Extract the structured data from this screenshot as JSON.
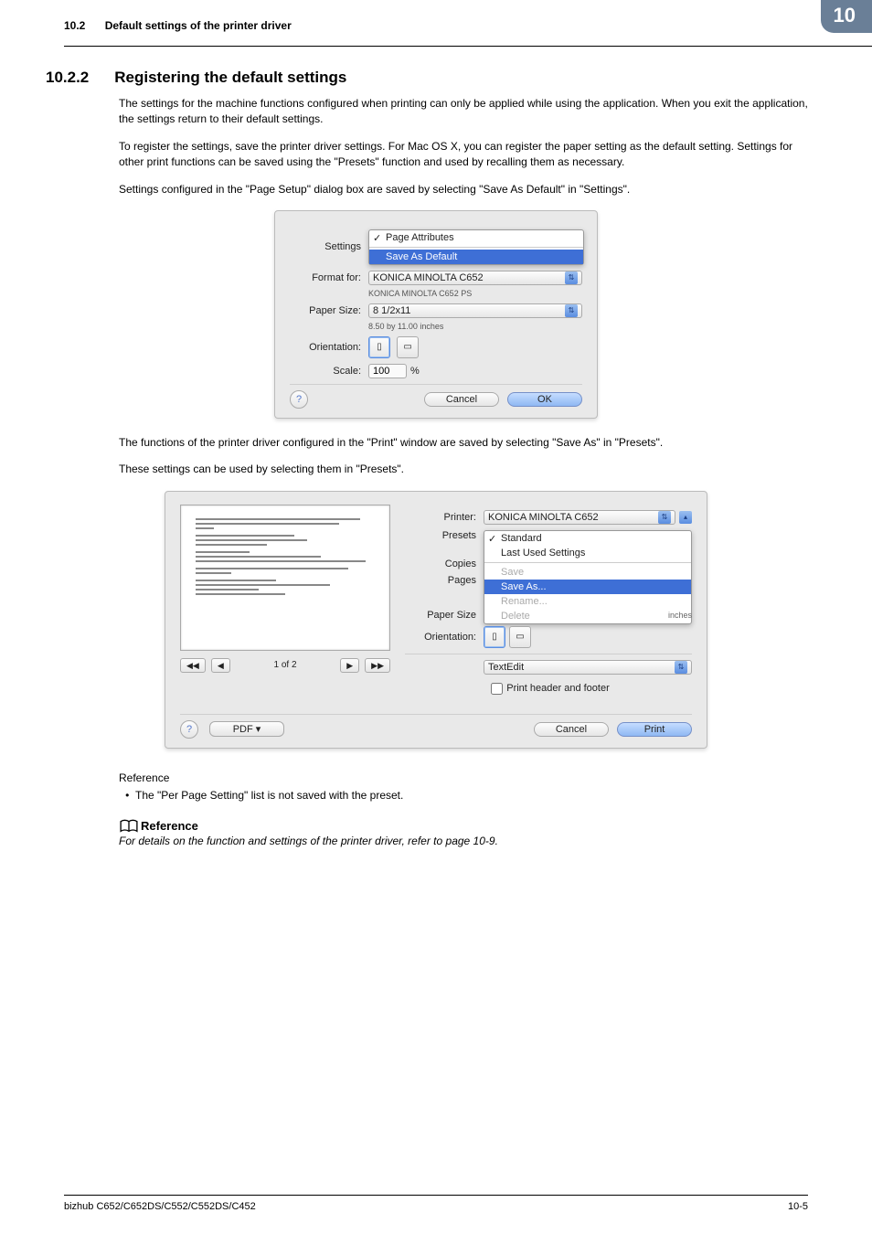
{
  "header": {
    "section_no": "10.2",
    "section_title": "Default settings of the printer driver",
    "chapter_no": "10"
  },
  "heading": {
    "number": "10.2.2",
    "title": "Registering the default settings"
  },
  "para1": "The settings for the machine functions configured when printing can only be applied while using the application. When you exit the application, the settings return to their default settings.",
  "para2": "To register the settings, save the printer driver settings. For Mac OS X, you can register the paper setting as the default setting. Settings for other print functions can be saved using the \"Presets\" function and used by recalling them as necessary.",
  "para3": "Settings configured in the \"Page Setup\" dialog box are saved by selecting \"Save As Default\" in \"Settings\".",
  "dialog1": {
    "settings_label": "Settings",
    "settings_opt_checked": "Page Attributes",
    "settings_opt_selected": "Save As Default",
    "format_for_label": "Format for:",
    "format_for_value": "KONICA MINOLTA C652",
    "format_for_sub": "KONICA MINOLTA C652 PS",
    "paper_size_label": "Paper Size:",
    "paper_size_value": "8 1/2x11",
    "paper_size_sub": "8.50 by 11.00 inches",
    "orientation_label": "Orientation:",
    "scale_label": "Scale:",
    "scale_value": "100",
    "scale_unit": "%",
    "cancel": "Cancel",
    "ok": "OK"
  },
  "para4": "The functions of the printer driver configured in the \"Print\" window are saved by selecting \"Save As\" in \"Presets\".",
  "para5": "These settings can be used by selecting them in \"Presets\".",
  "dialog2": {
    "printer_label": "Printer:",
    "printer_value": "KONICA MINOLTA C652",
    "presets_label": "Presets",
    "presets_opt_checked": "Standard",
    "presets_opt_last": "Last Used Settings",
    "presets_opt_save": "Save",
    "presets_opt_save_as": "Save As...",
    "presets_opt_rename": "Rename...",
    "presets_opt_delete": "Delete",
    "copies_label": "Copies",
    "pages_label": "Pages",
    "paper_size_label": "Paper Size",
    "paper_size_trail": "inches",
    "orientation_label": "Orientation:",
    "panel_value": "TextEdit",
    "chk_label": "Print header and footer",
    "page_counter": "1 of 2",
    "pdf_btn": "PDF ▾",
    "cancel": "Cancel",
    "print": "Print"
  },
  "reference_simple_head": "Reference",
  "reference_bullet": "The \"Per Page Setting\" list is not saved with the preset.",
  "reference_box_head": "Reference",
  "reference_box_text": "For details on the function and settings of the printer driver, refer to page 10-9.",
  "footer": {
    "left": "bizhub C652/C652DS/C552/C552DS/C452",
    "right": "10-5"
  }
}
